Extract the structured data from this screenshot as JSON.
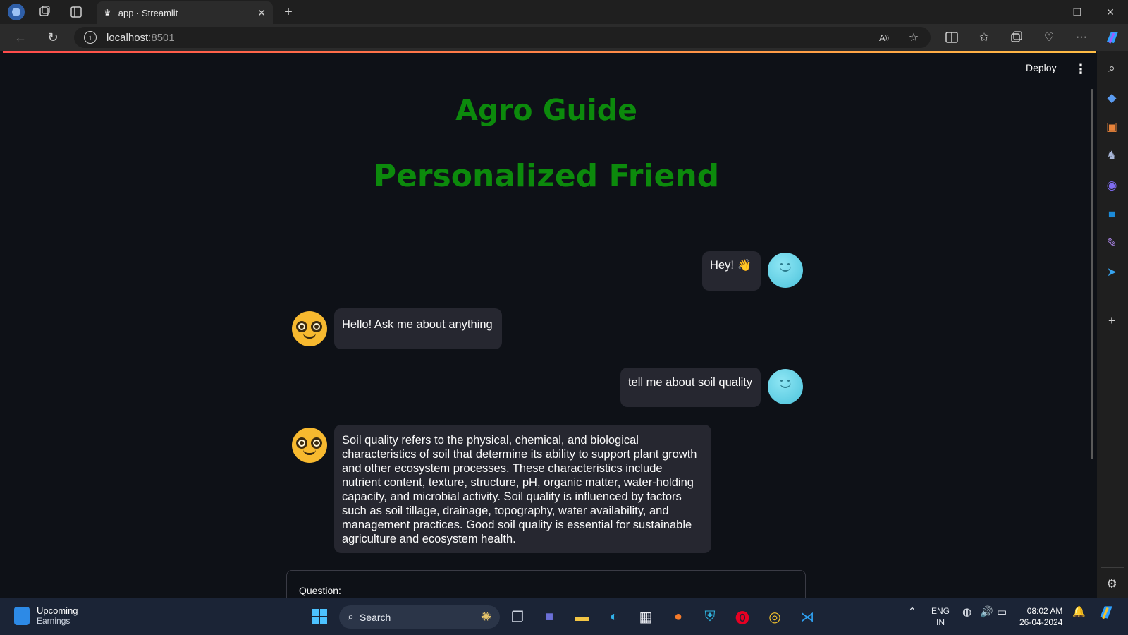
{
  "browser": {
    "tab_title": "app · Streamlit",
    "tab_close": "✕",
    "new_tab": "+",
    "url_host": "localhost",
    "url_port": ":8501",
    "window_controls": [
      "—",
      "❐",
      "✕"
    ]
  },
  "streamlit": {
    "deploy_label": "Deploy",
    "menu_glyph": "⋮",
    "title_line1": "Agro Guide",
    "title_line2": "Personalized Friend",
    "input_label": "Question:"
  },
  "chat": {
    "messages": [
      {
        "role": "user",
        "text": "Hey! 👋"
      },
      {
        "role": "bot",
        "text": "Hello! Ask me about anything"
      },
      {
        "role": "user",
        "text": "tell me about soil quality"
      },
      {
        "role": "bot",
        "text": "Soil quality refers to the physical, chemical, and biological characteristics of soil that determine its ability to support plant growth and other ecosystem processes. These characteristics include nutrient content, texture, structure, pH, organic matter, water-holding capacity, and microbial activity. Soil quality is influenced by factors such as soil tillage, drainage, topography, water availability, and management practices. Good soil quality is essential for sustainable agriculture and ecosystem health."
      }
    ]
  },
  "taskbar": {
    "widget_title": "Upcoming",
    "widget_subtitle": "Earnings",
    "search_label": "Search",
    "lang_line1": "ENG",
    "lang_line2": "IN",
    "time": "08:02 AM",
    "date": "26-04-2024"
  },
  "colors": {
    "title_green": "#0c8a0c",
    "bubble_bg": "#262730",
    "app_bg": "#0e1117"
  }
}
